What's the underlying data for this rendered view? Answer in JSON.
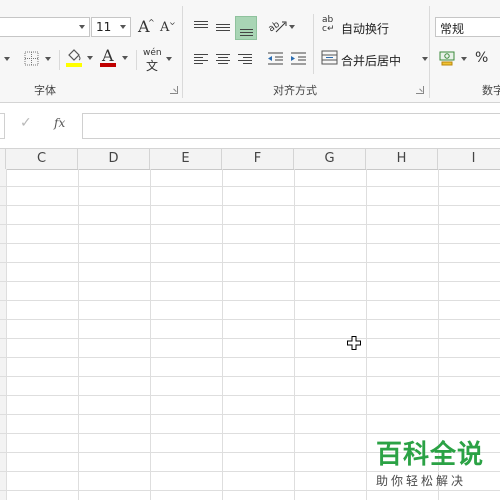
{
  "ribbon": {
    "font_group": {
      "label": "字体",
      "font_size_value": "11",
      "increase_font_glyph": "A",
      "decrease_font_glyph": "A",
      "pinyin_top": "wén",
      "pinyin_bottom": "文",
      "font_color": "#c00000",
      "fill_color": "#ffff00"
    },
    "align_group": {
      "label": "对齐方式",
      "wrap_text_label": "自动换行",
      "merge_center_label": "合并后居中",
      "wrap_glyph": "ab c"
    },
    "number_group": {
      "format_value": "常规",
      "percent_glyph": "%",
      "label_partial": "数字"
    }
  },
  "formula_bar": {
    "fx_label": "fx",
    "check_glyph": "✓",
    "value": ""
  },
  "grid": {
    "columns": [
      "C",
      "D",
      "E",
      "F",
      "G",
      "H",
      "I"
    ]
  },
  "watermark": {
    "main": "百科全说",
    "sub": "助你轻松解决"
  },
  "colors": {
    "accent_selected": "#a9d5b5",
    "watermark_green": "#2ba245"
  }
}
